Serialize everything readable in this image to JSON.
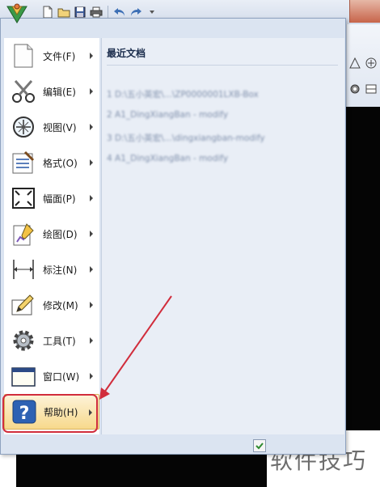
{
  "toolbar": {
    "icons": [
      "new-file-icon",
      "open-folder-icon",
      "save-icon",
      "print-icon",
      "undo-icon",
      "redo-icon"
    ]
  },
  "app_menu": {
    "items": [
      {
        "label": "文件(F)",
        "icon": "file-icon"
      },
      {
        "label": "编辑(E)",
        "icon": "scissors-icon"
      },
      {
        "label": "视图(V)",
        "icon": "zoom-icon"
      },
      {
        "label": "格式(O)",
        "icon": "format-icon"
      },
      {
        "label": "幅面(P)",
        "icon": "page-frame-icon"
      },
      {
        "label": "绘图(D)",
        "icon": "draw-icon"
      },
      {
        "label": "标注(N)",
        "icon": "dimension-icon"
      },
      {
        "label": "修改(M)",
        "icon": "modify-icon"
      },
      {
        "label": "工具(T)",
        "icon": "gear-icon"
      },
      {
        "label": "窗口(W)",
        "icon": "window-icon"
      },
      {
        "label": "帮助(H)",
        "icon": "help-icon"
      }
    ],
    "recent": {
      "title": "最近文档",
      "items": [
        "1 D:\\五小英宏\\...\\ZP0000001LXB-Box",
        "2 A1_DingXiangBan - modify",
        "3 D:\\五小英宏\\...\\dingxiangban-modify",
        "4 A1_DingXiangBan - modify"
      ]
    }
  },
  "watermark": "软件技巧",
  "colors": {
    "hover_fill": "#f7d98c",
    "annotation": "#d12d3c",
    "menu_bg": "#dbe4f1"
  }
}
